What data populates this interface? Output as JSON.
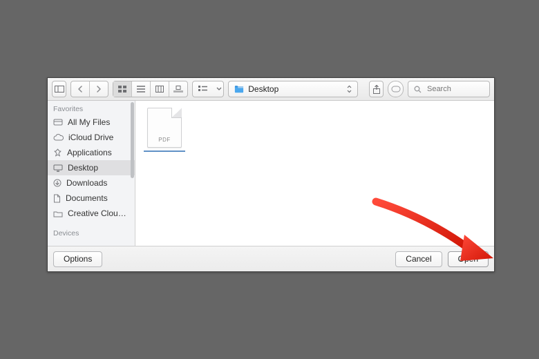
{
  "toolbar": {
    "path_label": "Desktop",
    "search_placeholder": "Search"
  },
  "sidebar": {
    "sections": {
      "favorites_label": "Favorites",
      "devices_label": "Devices"
    },
    "items": [
      {
        "label": "All My Files"
      },
      {
        "label": "iCloud Drive"
      },
      {
        "label": "Applications"
      },
      {
        "label": "Desktop"
      },
      {
        "label": "Downloads"
      },
      {
        "label": "Documents"
      },
      {
        "label": "Creative Clou…"
      }
    ]
  },
  "content": {
    "files": [
      {
        "type_tag": "PDF"
      }
    ]
  },
  "footer": {
    "options_label": "Options",
    "cancel_label": "Cancel",
    "open_label": "Open"
  }
}
